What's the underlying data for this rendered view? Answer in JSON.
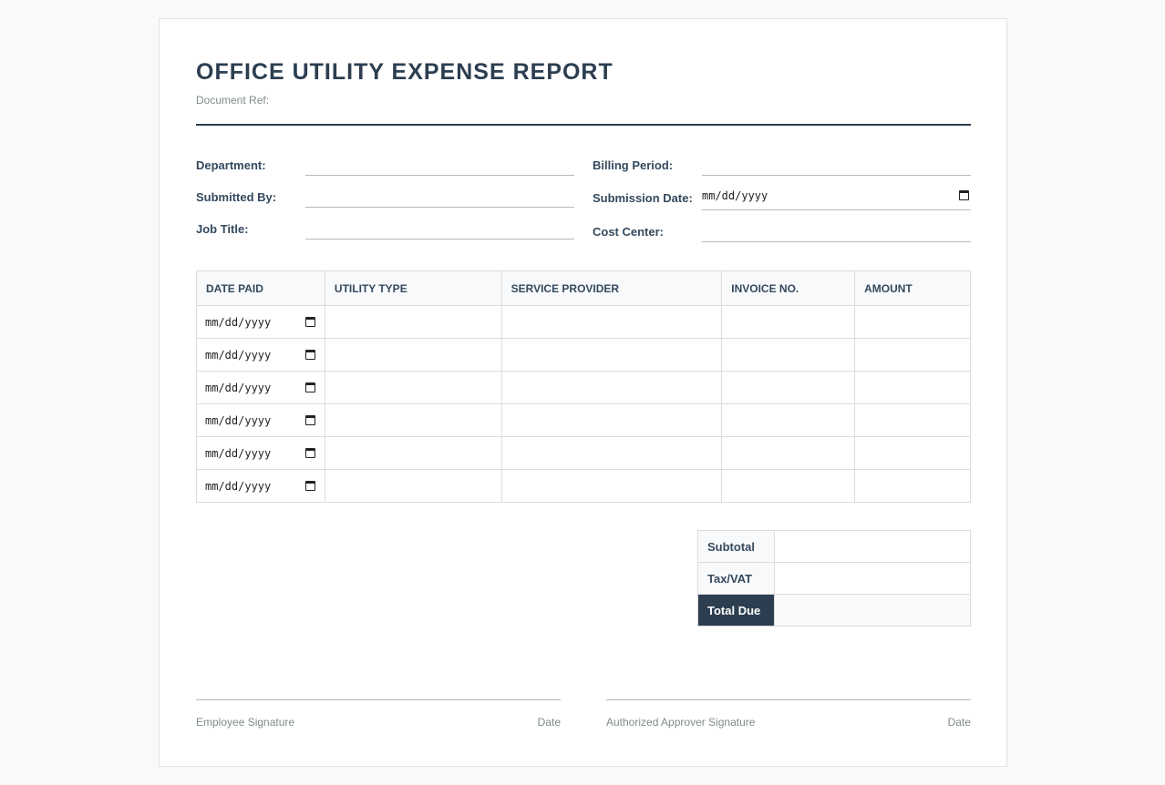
{
  "document": {
    "title": "OFFICE UTILITY EXPENSE REPORT",
    "doc_ref_label": "Document Ref:"
  },
  "fields": {
    "department": {
      "label": "Department:",
      "value": ""
    },
    "submitted_by": {
      "label": "Submitted By:",
      "value": ""
    },
    "job_title": {
      "label": "Job Title:",
      "value": ""
    },
    "billing_period": {
      "label": "Billing Period:",
      "value": ""
    },
    "submission_date": {
      "label": "Submission Date:",
      "placeholder": "mm/dd/yyyy"
    },
    "cost_center": {
      "label": "Cost Center:",
      "value": ""
    }
  },
  "table": {
    "headers": [
      "DATE PAID",
      "UTILITY TYPE",
      "SERVICE PROVIDER",
      "INVOICE NO.",
      "AMOUNT"
    ],
    "date_placeholder": "mm/dd/yyyy",
    "rows": [
      [
        "",
        "",
        "",
        ""
      ],
      [
        "",
        "",
        "",
        ""
      ],
      [
        "",
        "",
        "",
        ""
      ],
      [
        "",
        "",
        "",
        ""
      ],
      [
        "",
        "",
        "",
        ""
      ],
      [
        "",
        "",
        "",
        ""
      ]
    ]
  },
  "totals": {
    "subtotal_label": "Subtotal",
    "tax_label": "Tax/VAT",
    "total_label": "Total Due"
  },
  "signatures": {
    "employee_label": "Employee Signature",
    "employee_date_label": "Date",
    "approver_label": "Authorized Approver Signature",
    "approver_date_label": "Date"
  },
  "icons": {
    "date_picker": "calendar-icon"
  },
  "colors": {
    "primary": "#2c3e50",
    "muted": "#7f8c8d",
    "border": "#dcdcdc",
    "header_bg": "#f8f9fa"
  }
}
